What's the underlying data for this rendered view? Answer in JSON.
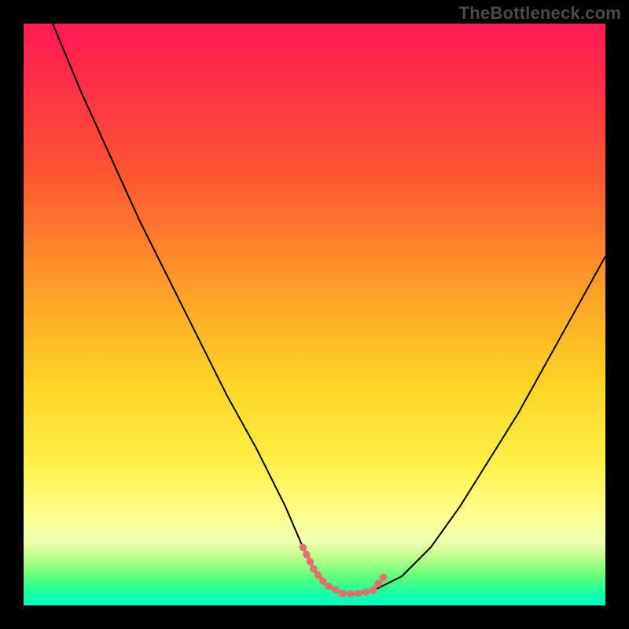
{
  "watermark": "TheBottleneck.com",
  "chart_data": {
    "type": "line",
    "title": "",
    "xlabel": "",
    "ylabel": "",
    "xlim": [
      0,
      100
    ],
    "ylim": [
      0,
      100
    ],
    "series": [
      {
        "name": "curve",
        "color": "#000000",
        "x": [
          5,
          10,
          15,
          20,
          25,
          30,
          35,
          40,
          45,
          48,
          50,
          52,
          55,
          57,
          60,
          65,
          70,
          75,
          80,
          85,
          90,
          95,
          100
        ],
        "y": [
          100,
          88,
          77,
          66,
          56,
          46,
          36,
          27,
          17,
          10,
          6,
          3.5,
          2,
          2,
          2.5,
          5,
          10,
          17,
          25,
          33,
          42,
          51,
          60
        ]
      },
      {
        "name": "highlight",
        "color": "#e86d6d",
        "x": [
          48,
          50,
          52,
          55,
          57,
          60,
          62
        ],
        "y": [
          10,
          6,
          3.5,
          2,
          2,
          2.5,
          5
        ]
      }
    ],
    "gradient_stops": [
      {
        "pct": 0,
        "color": "#ff1a55"
      },
      {
        "pct": 8,
        "color": "#ff2a4a"
      },
      {
        "pct": 25,
        "color": "#ff5233"
      },
      {
        "pct": 48,
        "color": "#ffa726"
      },
      {
        "pct": 62,
        "color": "#ffd426"
      },
      {
        "pct": 75,
        "color": "#ffef45"
      },
      {
        "pct": 84,
        "color": "#feff8a"
      },
      {
        "pct": 89,
        "color": "#f0ffb0"
      },
      {
        "pct": 92,
        "color": "#b6ff8a"
      },
      {
        "pct": 95,
        "color": "#62ff7a"
      },
      {
        "pct": 97.5,
        "color": "#1fff9e"
      },
      {
        "pct": 100,
        "color": "#00ffc3"
      }
    ]
  }
}
